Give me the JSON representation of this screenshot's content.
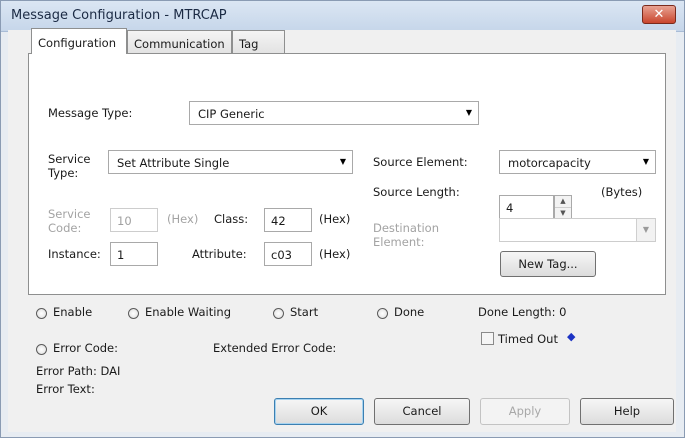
{
  "window": {
    "title": "Message Configuration - MTRCAP",
    "close_glyph": "✕"
  },
  "tabs": [
    {
      "label": "Configuration",
      "active": true
    },
    {
      "label": "Communication",
      "active": false
    },
    {
      "label": "Tag",
      "active": false
    }
  ],
  "config": {
    "message_type_label": "Message Type:",
    "message_type_value": "CIP Generic",
    "service_type_label_1": "Service",
    "service_type_label_2": "Type:",
    "service_type_value": "Set Attribute Single",
    "service_code_label_1": "Service",
    "service_code_label_2": "Code:",
    "service_code_value": "10",
    "service_code_unit": "(Hex)",
    "class_label": "Class:",
    "class_value": "42",
    "class_unit": "(Hex)",
    "instance_label": "Instance:",
    "instance_value": "1",
    "attribute_label": "Attribute:",
    "attribute_value": "c03",
    "attribute_unit": "(Hex)",
    "source_element_label": "Source Element:",
    "source_element_value": "motorcapacity",
    "source_length_label": "Source Length:",
    "source_length_value": "4",
    "source_length_unit": "(Bytes)",
    "destination_label_1": "Destination",
    "destination_label_2": "Element:",
    "destination_value": "",
    "new_tag_label": "New Tag..."
  },
  "status": {
    "enable": "Enable",
    "enable_waiting": "Enable Waiting",
    "start": "Start",
    "done": "Done",
    "done_length": "Done Length: 0",
    "error_code": "Error Code:",
    "extended_error_code": "Extended Error Code:",
    "timed_out": "Timed Out",
    "error_path": "Error Path: DAI",
    "error_text": "Error Text:"
  },
  "buttons": {
    "ok": "OK",
    "cancel": "Cancel",
    "apply": "Apply",
    "help": "Help"
  },
  "colors": {
    "accent_close": "#c9452d",
    "arrow": "#1c33c4"
  }
}
